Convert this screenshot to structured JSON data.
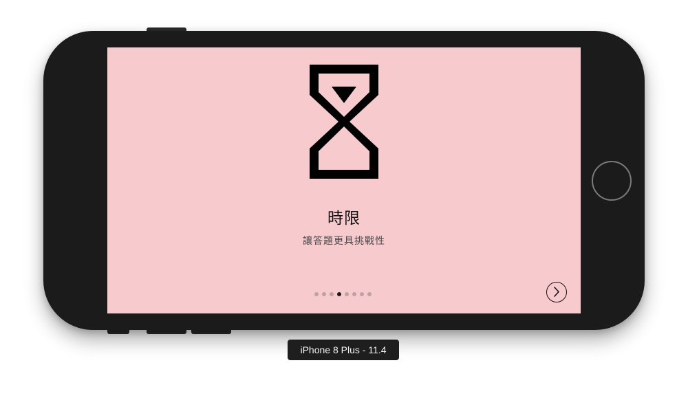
{
  "onboarding": {
    "title": "時限",
    "subtitle": "讓答題更具挑戰性",
    "page_count": 8,
    "current_page": 4,
    "icon": "hourglass-icon",
    "next_icon": "chevron-right-icon"
  },
  "simulator": {
    "device_label": "iPhone 8 Plus - 11.4"
  },
  "colors": {
    "screen_background": "#f7cbce",
    "device_body": "#1b1b1b",
    "dot_active": "#1a1a1a",
    "dot_inactive": "#bfa1a3"
  }
}
